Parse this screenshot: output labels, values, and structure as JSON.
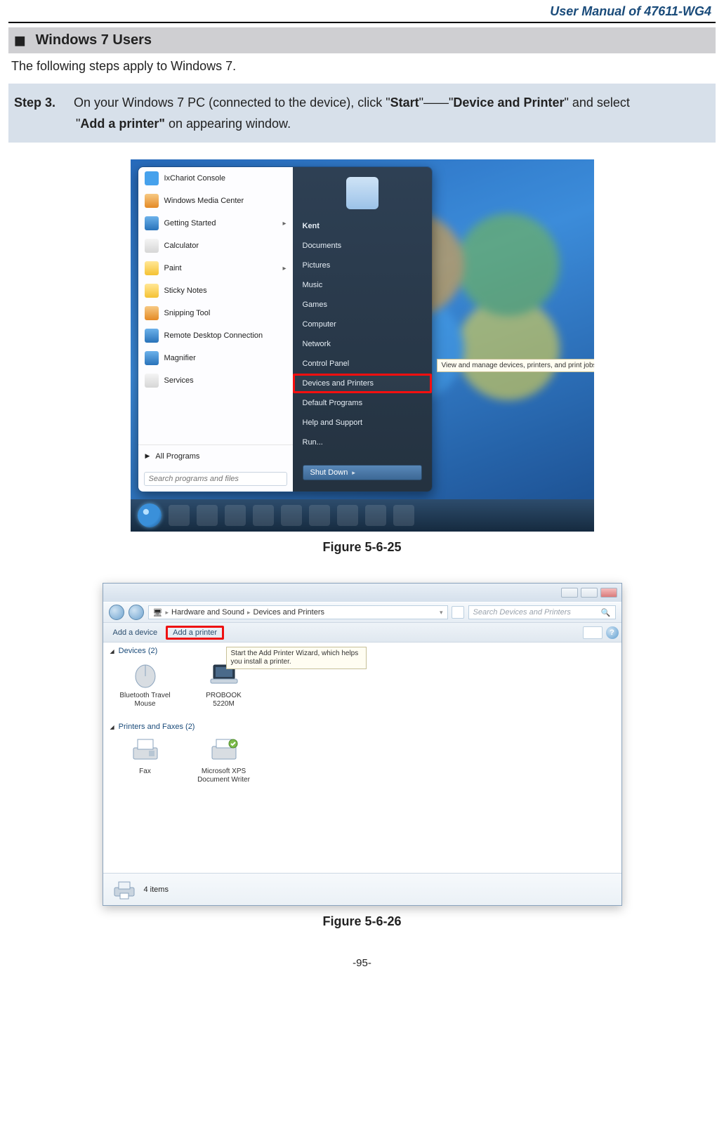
{
  "header": {
    "title": "User Manual of 47611-WG4"
  },
  "section": {
    "heading": "Windows 7 Users"
  },
  "intro": "The following steps apply to Windows 7.",
  "step": {
    "label": "Step 3.",
    "t1": "On your Windows 7 PC (connected to the device), click \"",
    "b1": "Start",
    "t2": "\"——\"",
    "b2": "Device and Printer",
    "t3": "\" and select",
    "line2_pre": "\"",
    "b3": "Add a printer\"",
    "line2_post": " on appearing window."
  },
  "fig1": {
    "caption": "Figure 5-6-25",
    "left_items": [
      "IxChariot Console",
      "Windows Media Center",
      "Getting Started",
      "Calculator",
      "Paint",
      "Sticky Notes",
      "Snipping Tool",
      "Remote Desktop Connection",
      "Magnifier",
      "Services"
    ],
    "left_arrows": [
      false,
      false,
      true,
      false,
      true,
      false,
      false,
      false,
      false,
      false
    ],
    "left_icon_cls": [
      "ic-ix",
      "ic-orange",
      "ic-blue",
      "ic-white",
      "ic-yellow",
      "ic-yellow",
      "ic-orange",
      "ic-blue",
      "ic-blue",
      "ic-white"
    ],
    "all_programs": "All Programs",
    "search_placeholder": "Search programs and files",
    "right_user": "Kent",
    "right_items": [
      "Documents",
      "Pictures",
      "Music",
      "Games",
      "Computer",
      "Network",
      "Control Panel",
      "Devices and Printers",
      "Default Programs",
      "Help and Support",
      "Run..."
    ],
    "right_highlight_index": 7,
    "tooltip": "View and manage devices, printers, and print jobs",
    "shutdown": "Shut Down"
  },
  "fig2": {
    "caption": "Figure 5-6-26",
    "crumb1": "Hardware and Sound",
    "crumb2": "Devices and Printers",
    "search_placeholder": "Search Devices and Printers",
    "cmd_add_device": "Add a device",
    "cmd_add_printer": "Add a printer",
    "tooltip": "Start the Add Printer Wizard, which helps you install a printer.",
    "group_devices": "Devices (2)",
    "group_printers": "Printers and Faxes (2)",
    "devices": [
      {
        "name": "Bluetooth Travel Mouse"
      },
      {
        "name": "PROBOOK 5220M"
      }
    ],
    "printers": [
      {
        "name": "Fax"
      },
      {
        "name": "Microsoft XPS Document Writer"
      }
    ],
    "status_text": "4 items"
  },
  "footer": {
    "page": "-95-"
  }
}
